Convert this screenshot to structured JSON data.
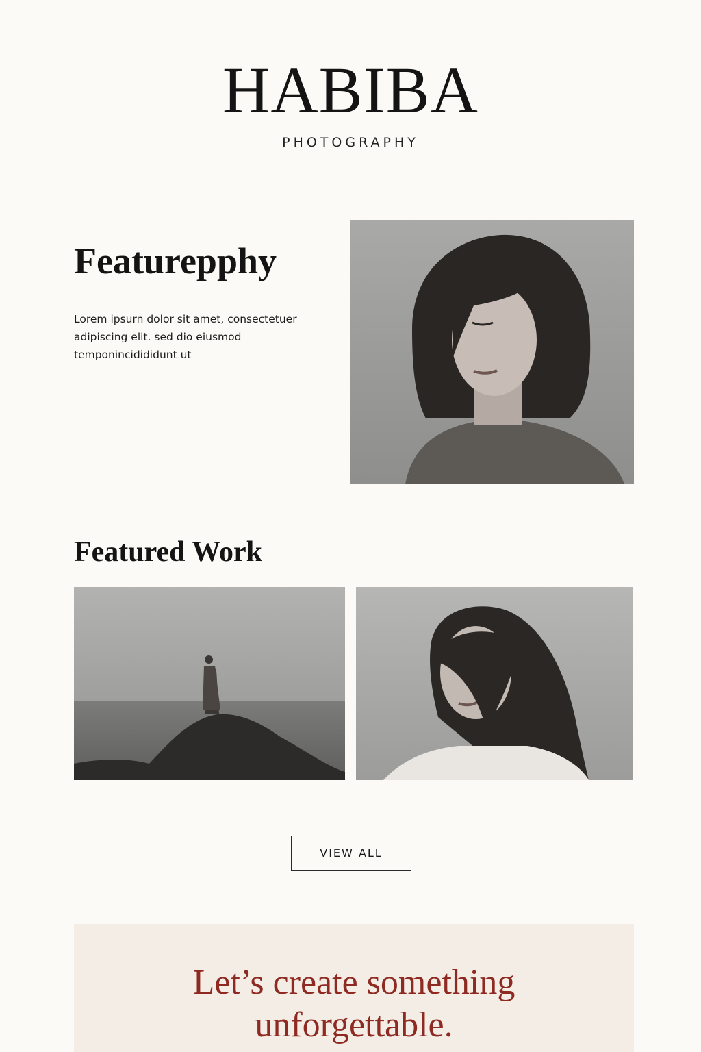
{
  "brand": {
    "name": "HABIBA",
    "tagline": "PHOTOGRAPHY"
  },
  "hero": {
    "title": "Featurepphy",
    "body": "Lorem ipsurn dolor sit amet, consectetuer adipiscing elit. sed dio eiusmod temponincidididunt ut"
  },
  "featured": {
    "title": "Featured Work",
    "view_all_label": "VIEW ALL"
  },
  "cta": {
    "line1": "Let’s create something",
    "line2": "unforgettable."
  },
  "colors": {
    "background": "#fcfaf6",
    "text": "#141414",
    "accent": "#8e2a22",
    "cta_background": "#f3ede6"
  }
}
